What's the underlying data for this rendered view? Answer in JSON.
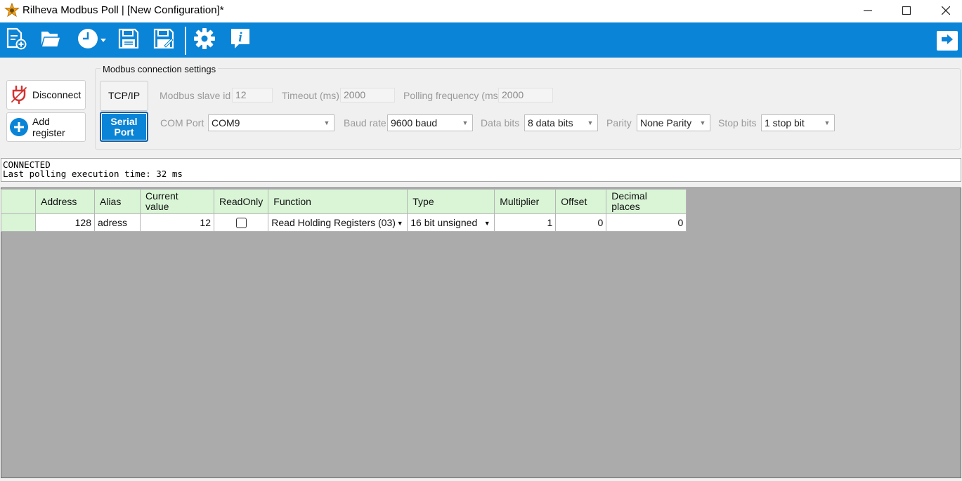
{
  "window": {
    "title": "Rilheva Modbus Poll | [New Configuration]*"
  },
  "toolbar": {
    "buttons": [
      "new-config",
      "open-config",
      "polling-history",
      "save",
      "save-as",
      "settings",
      "info"
    ],
    "accent": "#0a84d6"
  },
  "actions": {
    "disconnect_label": "Disconnect",
    "add_register_label": "Add register"
  },
  "connection": {
    "group_label": "Modbus connection settings",
    "tcp_label": "TCP/IP",
    "serial_label_1": "Serial",
    "serial_label_2": "Port",
    "slave_id_label": "Modbus slave id",
    "slave_id_value": "12",
    "timeout_label": "Timeout (ms)",
    "timeout_value": "2000",
    "polling_label": "Polling frequency (ms)",
    "polling_value": "2000",
    "com_port_label": "COM Port",
    "com_port_value": "COM9",
    "baud_label": "Baud rate",
    "baud_value": "9600 baud",
    "data_bits_label": "Data bits",
    "data_bits_value": "8 data bits",
    "parity_label": "Parity",
    "parity_value": "None Parity",
    "stop_bits_label": "Stop bits",
    "stop_bits_value": "1 stop bit"
  },
  "status": {
    "line1": "CONNECTED",
    "line2": "Last polling execution time: 32 ms"
  },
  "grid": {
    "headers": {
      "address": "Address",
      "alias": "Alias",
      "current_value_1": "Current",
      "current_value_2": "value",
      "readonly": "ReadOnly",
      "function": "Function",
      "type": "Type",
      "multiplier": "Multiplier",
      "offset": "Offset",
      "decimal_1": "Decimal",
      "decimal_2": "places"
    },
    "rows": [
      {
        "address": "128",
        "alias": "adress",
        "current_value": "12",
        "readonly": false,
        "function": "Read Holding Registers (03)",
        "type": "16 bit unsigned",
        "multiplier": "1",
        "offset": "0",
        "decimal_places": "0"
      }
    ]
  }
}
